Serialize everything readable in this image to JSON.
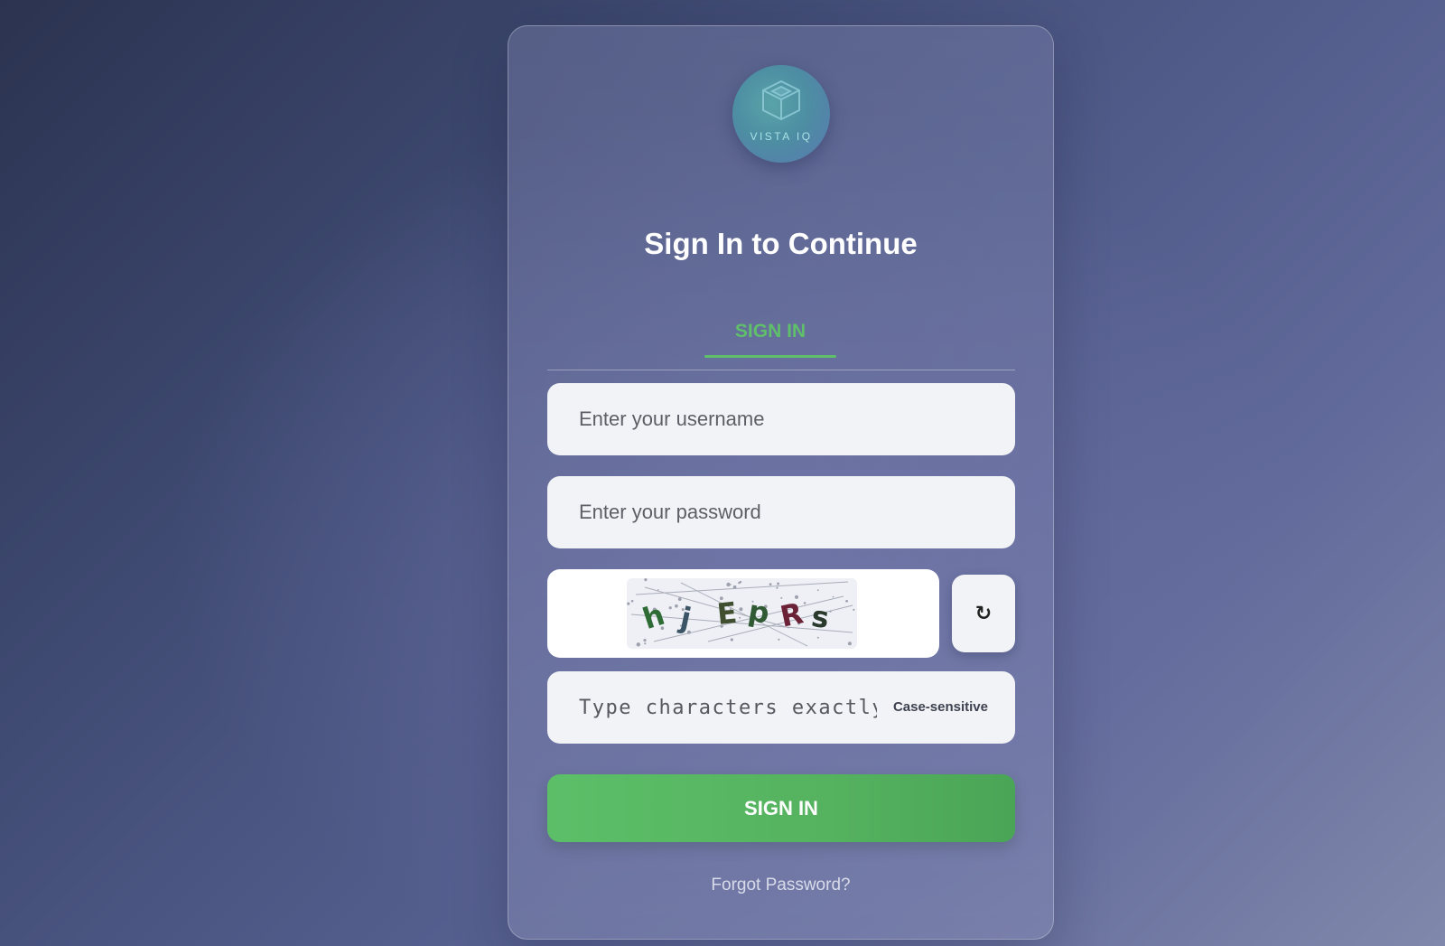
{
  "brand": {
    "logo_text": "VISTA IQ",
    "logo_icon": "cube-icon"
  },
  "page": {
    "title": "Sign In to Continue"
  },
  "tabs": [
    {
      "label": "SIGN IN",
      "active": true
    }
  ],
  "form": {
    "username_placeholder": "Enter your username",
    "password_placeholder": "Enter your password",
    "captcha": {
      "characters": [
        "h",
        "j",
        "E",
        "p",
        "R",
        "s"
      ],
      "char_colors": [
        "#2f6b35",
        "#3b5566",
        "#3f4f30",
        "#2f5a34",
        "#6b2236",
        "#2a3a2c"
      ],
      "refresh_symbol": "↻",
      "refresh_icon": "refresh-icon",
      "input_placeholder": "Type characters exactly",
      "hint": "Case-sensitive"
    },
    "submit_label": "SIGN IN",
    "forgot_label": "Forgot Password?"
  },
  "colors": {
    "accent": "#5fbf6a",
    "button": "#55b25f"
  }
}
